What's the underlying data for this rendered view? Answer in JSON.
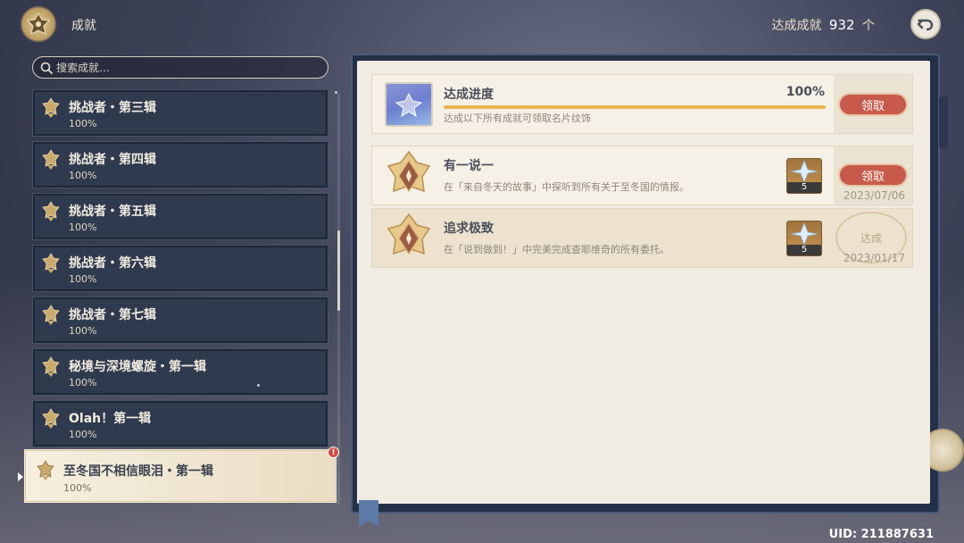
{
  "header": {
    "title": "成就",
    "count_label": "达成成就",
    "count_value": "932",
    "count_unit": "个"
  },
  "search": {
    "placeholder": "搜索成就…"
  },
  "categories": [
    {
      "name": "挑战者・第三辑",
      "percent": "100%"
    },
    {
      "name": "挑战者・第四辑",
      "percent": "100%"
    },
    {
      "name": "挑战者・第五辑",
      "percent": "100%"
    },
    {
      "name": "挑战者・第六辑",
      "percent": "100%"
    },
    {
      "name": "挑战者・第七辑",
      "percent": "100%"
    },
    {
      "name": "秘境与深境螺旋・第一辑",
      "percent": "100%"
    },
    {
      "name": "Olah！第一辑",
      "percent": "100%"
    },
    {
      "name": "至冬国不相信眼泪・第一辑",
      "percent": "100%",
      "selected": true,
      "alert": "!"
    }
  ],
  "progress_row": {
    "title": "达成进度",
    "percent": "100%",
    "progress": 1.0,
    "description": "达成以下所有成就可领取名片纹饰",
    "claim_label": "领取"
  },
  "achievements": [
    {
      "title": "有一说一",
      "description": "在「来自冬天的故事」中探听到所有关于至冬国的情报。",
      "reward_count": "5",
      "claim_label": "领取",
      "date": "2023/07/06",
      "status": "claimable"
    },
    {
      "title": "追求极致",
      "description": "在「说到做到！」中完美完成查耶维奇的所有委托。",
      "reward_count": "5",
      "stamp_label": "达成",
      "date": "2023/01/17",
      "status": "completed"
    }
  ],
  "footer": {
    "uid": "UID: 211887631"
  },
  "colors": {
    "accent_red": "#c75a4a",
    "progress_gold": "#e9b650",
    "panel_navy": "#2f3a4f",
    "page_cream": "#f1ece1"
  },
  "icons": [
    "achievement-emblem-icon",
    "search-icon",
    "back-arrow-icon",
    "category-badge-icon",
    "primogem-icon"
  ]
}
